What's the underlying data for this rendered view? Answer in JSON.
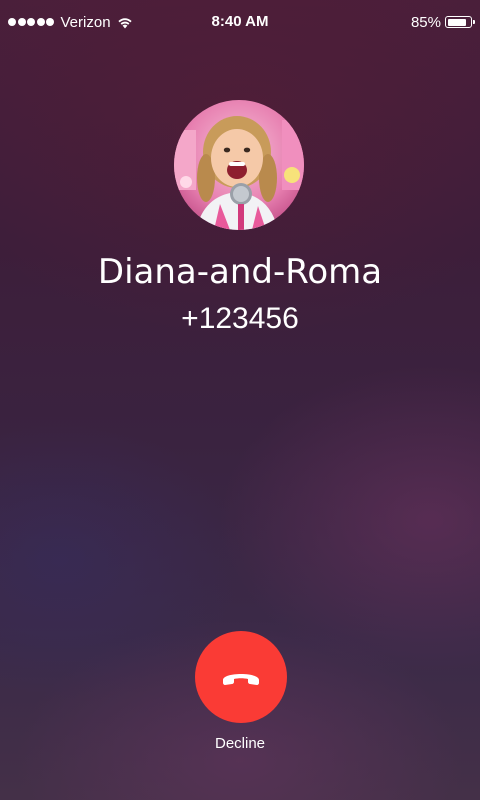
{
  "status_bar": {
    "carrier": "Verizon",
    "signal_bars": 5,
    "wifi_icon": "wifi-icon",
    "time": "8:40 AM",
    "battery_percent": "85%",
    "battery_level": 0.85
  },
  "call": {
    "caller_name": "Diana-and-Roma",
    "caller_number": "+123456",
    "avatar_icon": "contact-avatar-photo"
  },
  "actions": {
    "decline_label": "Decline",
    "decline_icon": "phone-hangup-icon",
    "decline_color": "#fa3b35"
  }
}
